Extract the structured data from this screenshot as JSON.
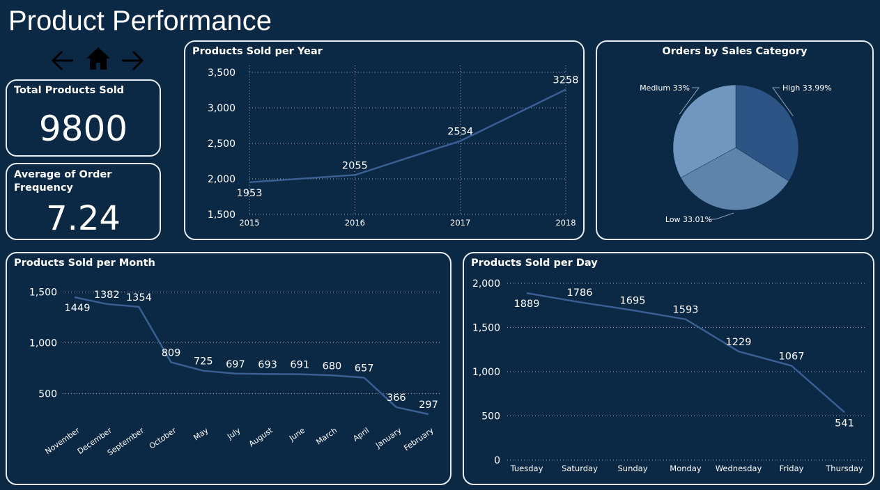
{
  "page": {
    "title": "Product Performance",
    "colors": {
      "background": "#0b2844",
      "card_border": "#e6edf5",
      "line": "#3a5f93",
      "pie_high": "#2c5586",
      "pie_low": "#5e84ab",
      "pie_medium": "#7097bf",
      "grid": "#8fa6bf"
    }
  },
  "nav": {
    "back_icon": "arrow-left-icon",
    "home_icon": "home-icon",
    "forward_icon": "arrow-right-icon"
  },
  "kpis": {
    "total_products": {
      "label": "Total Products Sold",
      "value": "9800"
    },
    "avg_order_frequency": {
      "label": "Average of Order Frequency",
      "value": "7.24"
    }
  },
  "chart_data": [
    {
      "id": "per_year",
      "type": "line",
      "title": "Products Sold per Year",
      "categories": [
        "2015",
        "2016",
        "2017",
        "2018"
      ],
      "values": [
        1953,
        2055,
        2534,
        3258
      ],
      "data_labels": [
        "1953",
        "2055",
        "2534",
        "3258"
      ],
      "ylim": [
        1500,
        3500
      ],
      "yticks": [
        1500,
        2000,
        2500,
        3000,
        3500
      ],
      "ytick_labels": [
        "1,500",
        "2,000",
        "2,500",
        "3,000",
        "3,500"
      ],
      "grid": "dotted, vertical and horizontal"
    },
    {
      "id": "sales_category",
      "type": "pie",
      "title": "Orders by Sales Category",
      "slices": [
        {
          "label": "High 33.99%",
          "value": 33.99
        },
        {
          "label": "Low 33.01%",
          "value": 33.01
        },
        {
          "label": "Medium 33%",
          "value": 33.0
        }
      ]
    },
    {
      "id": "per_month",
      "type": "line",
      "title": "Products Sold per Month",
      "categories": [
        "November",
        "December",
        "September",
        "October",
        "May",
        "July",
        "August",
        "June",
        "March",
        "April",
        "January",
        "February"
      ],
      "values": [
        1449,
        1382,
        1354,
        809,
        725,
        697,
        693,
        691,
        680,
        657,
        366,
        297
      ],
      "data_labels": [
        "1449",
        "1382",
        "1354",
        "809",
        "725",
        "697",
        "693",
        "691",
        "680",
        "657",
        "366",
        "297"
      ],
      "ylim": [
        250,
        1600
      ],
      "yticks": [
        500,
        1000,
        1500
      ],
      "ytick_labels": [
        "500",
        "1,000",
        "1,500"
      ],
      "grid": "dotted horizontal"
    },
    {
      "id": "per_day",
      "type": "line",
      "title": "Products Sold per Day",
      "categories": [
        "Tuesday",
        "Saturday",
        "Sunday",
        "Monday",
        "Wednesday",
        "Friday",
        "Thursday"
      ],
      "values": [
        1889,
        1786,
        1695,
        1593,
        1229,
        1067,
        541
      ],
      "data_labels": [
        "1889",
        "1786",
        "1695",
        "1593",
        "1229",
        "1067",
        "541"
      ],
      "ylim": [
        0,
        2000
      ],
      "yticks": [
        0,
        500,
        1000,
        1500,
        2000
      ],
      "ytick_labels": [
        "0",
        "500",
        "1,000",
        "1,500",
        "2,000"
      ],
      "grid": "dotted horizontal"
    }
  ]
}
